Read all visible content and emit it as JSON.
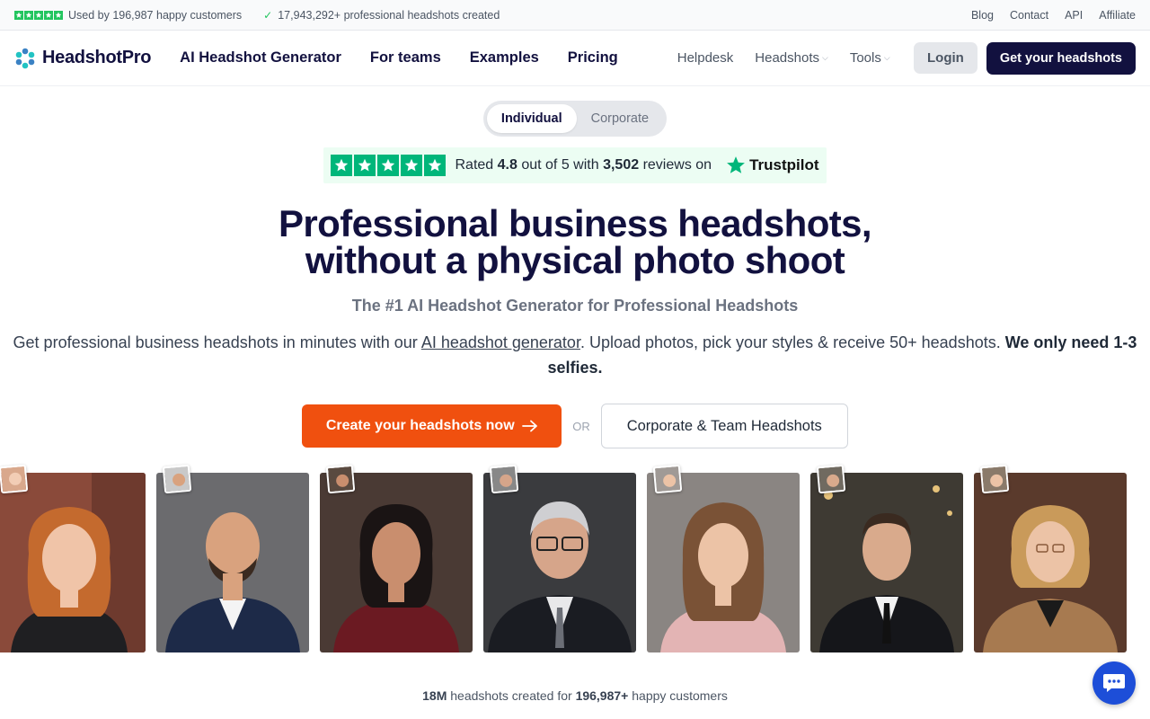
{
  "topbar": {
    "customers_text": "Used by 196,987 happy customers",
    "headshots_text": "17,943,292+ professional headshots created",
    "links": [
      "Blog",
      "Contact",
      "API",
      "Affiliate"
    ]
  },
  "nav": {
    "logo": "HeadshotPro",
    "main": [
      "AI Headshot Generator",
      "For teams",
      "Examples",
      "Pricing"
    ],
    "helpdesk": "Helpdesk",
    "headshots": "Headshots",
    "tools": "Tools",
    "login": "Login",
    "get": "Get your headshots"
  },
  "toggle": {
    "individual": "Individual",
    "corporate": "Corporate"
  },
  "trustpilot": {
    "rated": "Rated",
    "score": "4.8",
    "out_of": "out of 5 with",
    "count": "3,502",
    "reviews_on": "reviews on",
    "brand": "Trustpilot"
  },
  "hero": {
    "title_line1": "Professional business headshots,",
    "title_line2": "without a physical photo shoot",
    "subtitle": "The #1 AI Headshot Generator for Professional Headshots",
    "lead_part1": "Get professional business headshots in minutes with our",
    "lead_link": "AI headshot generator",
    "lead_part2": ". Upload photos, pick your styles & receive 50+ headshots.",
    "lead_bold": "We only need 1-3 selfies."
  },
  "cta": {
    "create": "Create your headshots now",
    "or": "OR",
    "corporate": "Corporate & Team Headshots"
  },
  "stats": {
    "count": "18M",
    "mid": "headshots created for",
    "customers": "196,987+",
    "end": "happy customers"
  },
  "colors": {
    "navy": "#12113f",
    "orange": "#f0500f",
    "trustpilot_green": "#00b67a",
    "chat_blue": "#1d4ed8"
  }
}
